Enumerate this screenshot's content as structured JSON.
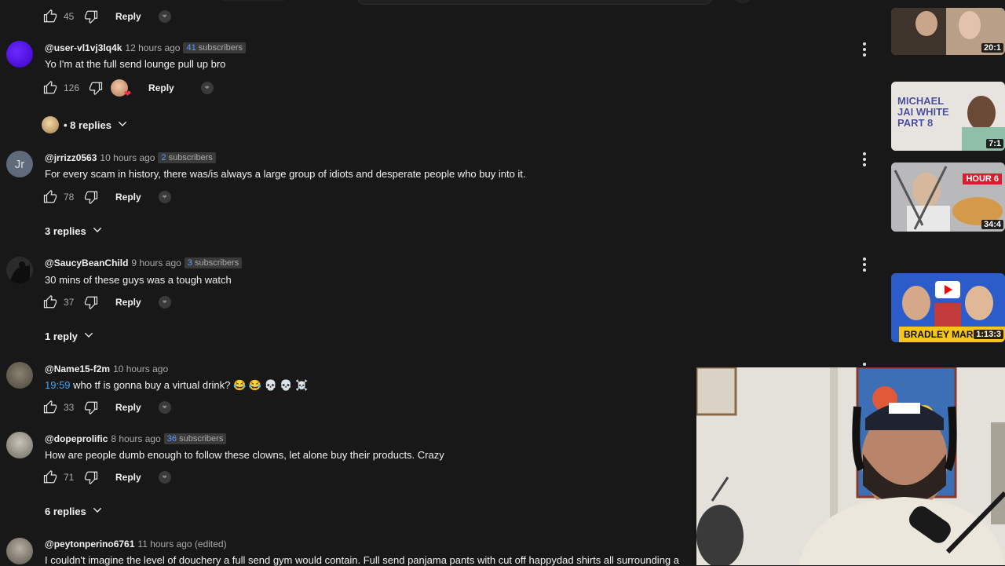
{
  "top_comment": {
    "likes": "45",
    "reply_label": "Reply"
  },
  "comments": [
    {
      "handle": "@user-vl1vj3lq4k",
      "time": "12 hours ago",
      "subs_num": "41",
      "subs_word": "subscribers",
      "text": "Yo I'm at the full send lounge pull up bro",
      "likes": "126",
      "reply_label": "Reply",
      "replies_label": "• 8 replies"
    },
    {
      "handle": "@jrrizz0563",
      "time": "10 hours ago",
      "subs_num": "2",
      "subs_word": "subscribers",
      "avatar_initials": "Jr",
      "text": "For every scam in history, there was/is always a large group of idiots and desperate people who buy into it.",
      "likes": "78",
      "reply_label": "Reply",
      "replies_label": "3 replies"
    },
    {
      "handle": "@SaucyBeanChild",
      "time": "9 hours ago",
      "subs_num": "3",
      "subs_word": "subscribers",
      "text": "30 mins of these guys was a tough watch",
      "likes": "37",
      "reply_label": "Reply",
      "replies_label": "1 reply"
    },
    {
      "handle": "@Name15-f2m",
      "time": "10 hours ago",
      "timestamp_link": "19:59",
      "text": "who tf is gonna buy a virtual drink? 😂 😂 💀 💀 ☠️",
      "likes": "33",
      "reply_label": "Reply"
    },
    {
      "handle": "@dopeprolific",
      "time": "8 hours ago",
      "subs_num": "36",
      "subs_word": "subscribers",
      "text": "How are people dumb enough to follow these clowns, let alone buy their products. Crazy",
      "likes": "71",
      "reply_label": "Reply",
      "replies_label": "6 replies"
    },
    {
      "handle": "@peytonperino6761",
      "time": "11 hours ago (edited)",
      "text": "I couldn't imagine the level of douchery a full send gym would contain. Full send panjama pants with cut off happydad shirts all surrounding a"
    }
  ],
  "sidebar_videos": [
    {
      "duration": "20:1"
    },
    {
      "duration": "7:1",
      "title_overlay": "MICHAEL JAI WHITE PART 8"
    },
    {
      "duration": "34:4",
      "title_overlay": "HOUR 6"
    },
    {
      "duration": "1:13:3",
      "title_overlay": "BRADLEY MAR"
    }
  ],
  "colors": {
    "background": "#181818",
    "link": "#3ea6ff",
    "subs_num": "#5b9bff"
  }
}
